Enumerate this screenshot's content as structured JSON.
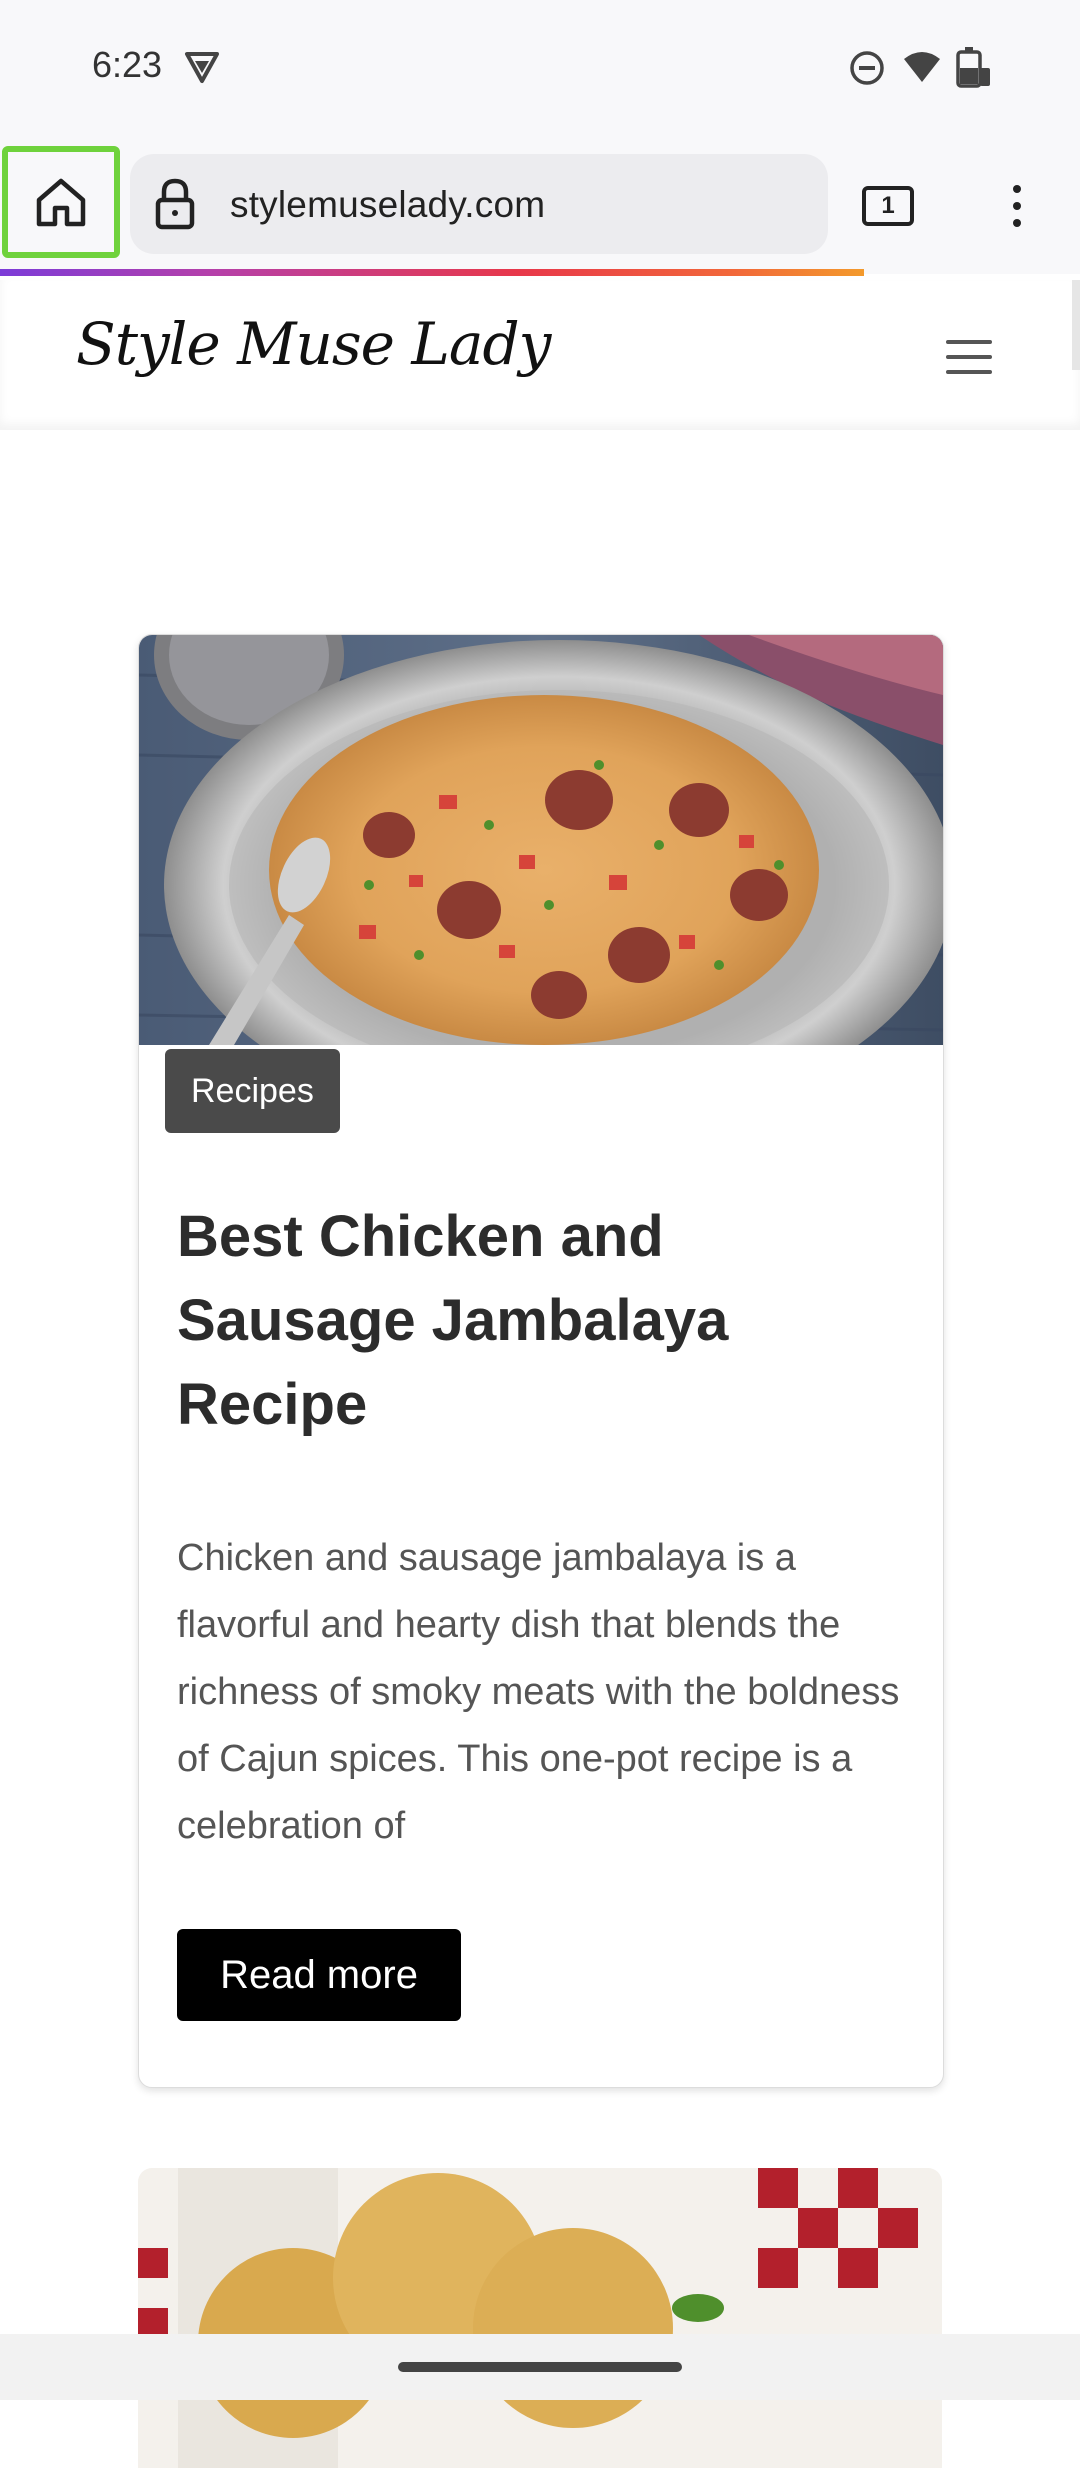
{
  "status_bar": {
    "time": "6:23",
    "icons": [
      "vpn-shield-icon",
      "do-not-disturb-icon",
      "wifi-icon",
      "battery-charging-icon"
    ]
  },
  "browser": {
    "url": "stylemuselady.com",
    "tab_count": "1",
    "home_button_highlight_color": "#6fd23c",
    "icons": [
      "home-icon",
      "lock-icon",
      "tabs-icon",
      "more-vert-icon"
    ]
  },
  "site": {
    "logo": "Style Muse Lady",
    "menu_icon": "hamburger-icon"
  },
  "card": {
    "category": "Recipes",
    "title": "Best Chicken and Sausage Jambalaya Recipe",
    "excerpt": "Chicken and sausage jambalaya is a flavorful and hearty dish that blends the richness of smoky meats with the boldness of Cajun spices. This one-pot recipe is a celebration of",
    "read_more": "Read more"
  }
}
